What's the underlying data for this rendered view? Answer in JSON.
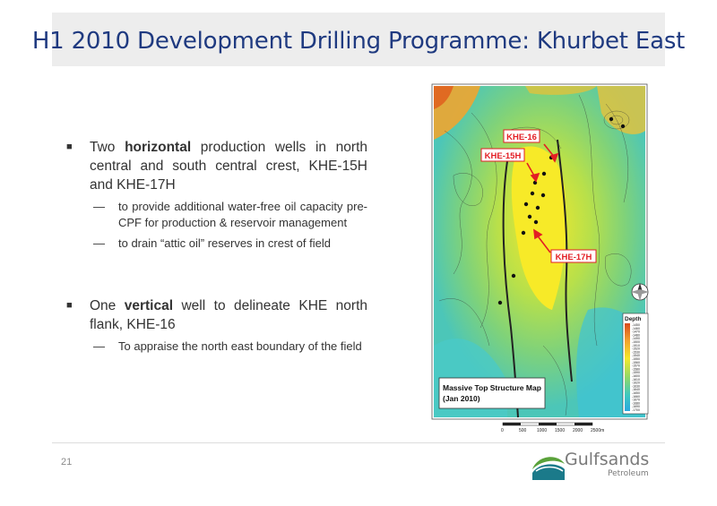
{
  "slide": {
    "title": "H1 2010 Development Drilling Programme: Khurbet East",
    "page_number": "21"
  },
  "bullets": [
    {
      "pre": "Two ",
      "bold": "horizontal",
      "post": " production wells in north central and south central crest, KHE-15H and KHE-17H",
      "subs": [
        "to provide additional water-free oil capacity pre-CPF for production & reservoir management",
        "to drain “attic oil” reserves in crest of field"
      ]
    },
    {
      "pre": "One ",
      "bold": "vertical",
      "post": " well to delineate KHE north flank, KHE-16",
      "subs": [
        "To appraise the north east boundary of the field"
      ]
    }
  ],
  "map": {
    "callouts": [
      "KHE-16",
      "KHE-15H",
      "KHE-17H"
    ],
    "caption_line1": "Massive Top Structure Map",
    "caption_line2": "(Jan 2010)",
    "legend_title": "Depth",
    "legend_values": [
      "-1450",
      "-1460",
      "-1470",
      "-1480",
      "-1490",
      "-1500",
      "-1510",
      "-1520",
      "-1530",
      "-1540",
      "-1550",
      "-1560",
      "-1570",
      "-1580",
      "-1590",
      "-1600",
      "-1610",
      "-1620",
      "-1630",
      "-1640",
      "-1650",
      "-1660",
      "-1670",
      "-1680",
      "-1690",
      "-1700"
    ],
    "scale_labels": [
      "0",
      "500",
      "1000",
      "1500",
      "2000",
      "2500m"
    ],
    "colors": {
      "callout_red": "#e31e24",
      "shallow": "#d84a1c",
      "crest": "#f5e82a",
      "deep": "#2dbfd8"
    }
  },
  "logo": {
    "name": "Gulfsands",
    "sub": "Petroleum",
    "colors": {
      "teal": "#1b7a8a",
      "green": "#5aa23a",
      "text": "#7a7a7a"
    }
  }
}
